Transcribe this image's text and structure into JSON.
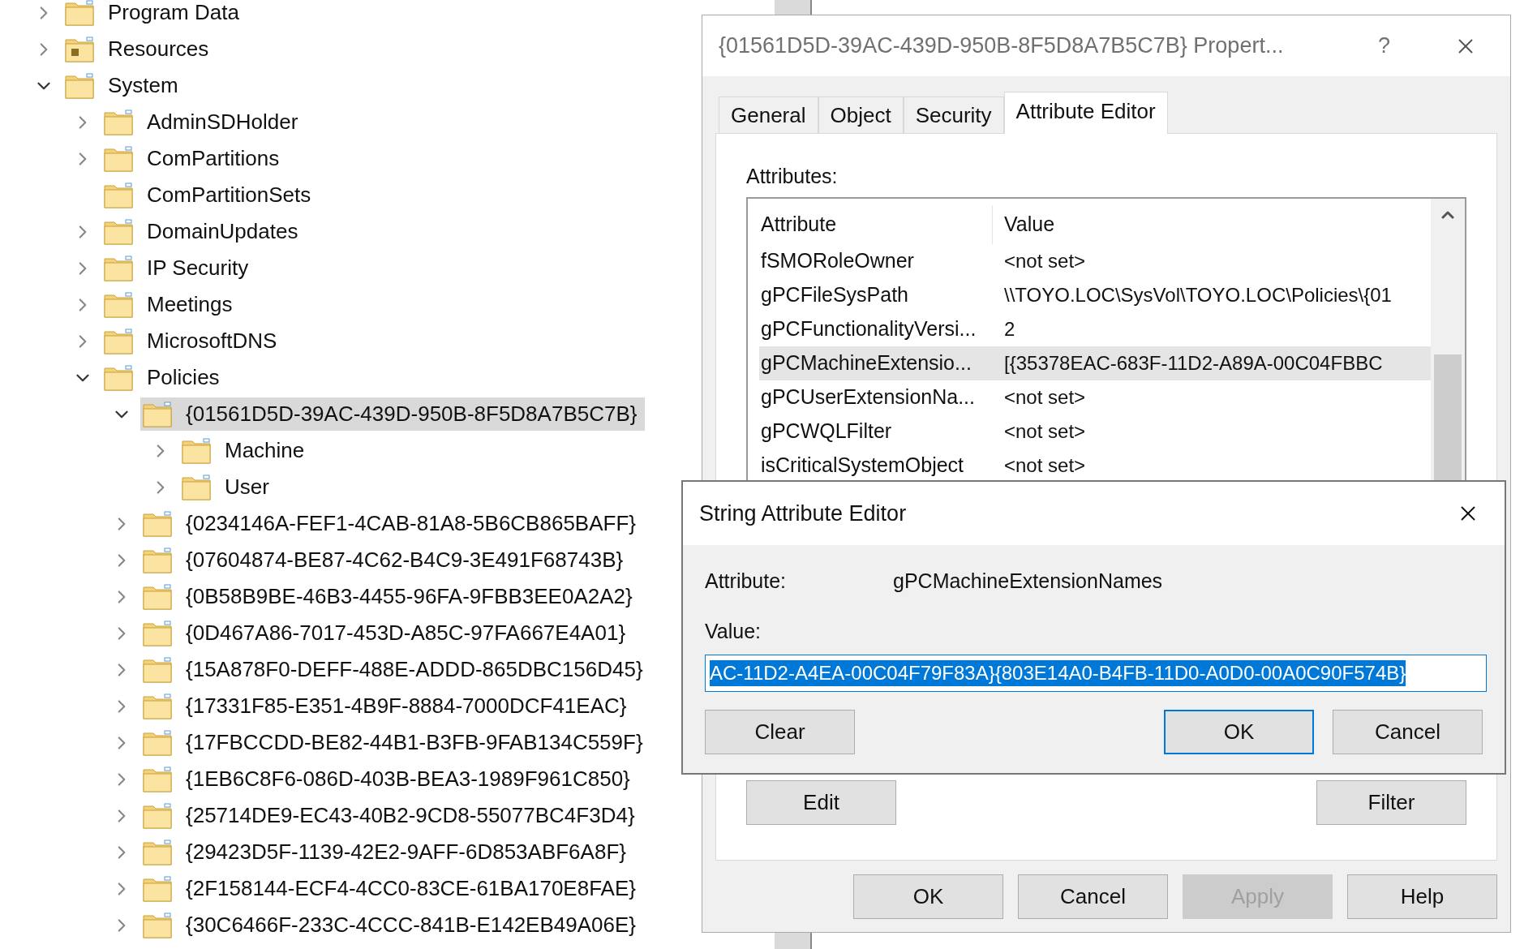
{
  "tree": [
    {
      "label": "Program Data",
      "kind": "folder",
      "expanded": false,
      "selected": false
    },
    {
      "label": "Resources",
      "kind": "container",
      "expanded": false,
      "selected": false
    },
    {
      "label": "System",
      "kind": "folder",
      "expanded": true,
      "selected": false,
      "children": [
        {
          "label": "AdminSDHolder",
          "kind": "folder",
          "expanded": false,
          "selected": false
        },
        {
          "label": "ComPartitions",
          "kind": "folder",
          "expanded": false,
          "selected": false
        },
        {
          "label": "ComPartitionSets",
          "kind": "folder",
          "selected": false
        },
        {
          "label": "DomainUpdates",
          "kind": "folder",
          "expanded": false,
          "selected": false
        },
        {
          "label": "IP Security",
          "kind": "folder",
          "expanded": false,
          "selected": false
        },
        {
          "label": "Meetings",
          "kind": "folder",
          "expanded": false,
          "selected": false
        },
        {
          "label": "MicrosoftDNS",
          "kind": "folder",
          "expanded": false,
          "selected": false
        },
        {
          "label": "Policies",
          "kind": "folder",
          "expanded": true,
          "selected": false,
          "children": [
            {
              "label": "{01561D5D-39AC-439D-950B-8F5D8A7B5C7B}",
              "kind": "folder",
              "expanded": true,
              "selected": true,
              "children": [
                {
                  "label": "Machine",
                  "kind": "folder",
                  "expanded": false,
                  "selected": false
                },
                {
                  "label": "User",
                  "kind": "folder",
                  "expanded": false,
                  "selected": false
                }
              ]
            },
            {
              "label": "{0234146A-FEF1-4CAB-81A8-5B6CB865BAFF}",
              "kind": "folder",
              "expanded": false,
              "selected": false
            },
            {
              "label": "{07604874-BE87-4C62-B4C9-3E491F68743B}",
              "kind": "folder",
              "expanded": false,
              "selected": false
            },
            {
              "label": "{0B58B9BE-46B3-4455-96FA-9FBB3EE0A2A2}",
              "kind": "folder",
              "expanded": false,
              "selected": false
            },
            {
              "label": "{0D467A86-7017-453D-A85C-97FA667E4A01}",
              "kind": "folder",
              "expanded": false,
              "selected": false
            },
            {
              "label": "{15A878F0-DEFF-488E-ADDD-865DBC156D45}",
              "kind": "folder",
              "expanded": false,
              "selected": false
            },
            {
              "label": "{17331F85-E351-4B9F-8884-7000DCF41EAC}",
              "kind": "folder",
              "expanded": false,
              "selected": false
            },
            {
              "label": "{17FBCCDD-BE82-44B1-B3FB-9FAB134C559F}",
              "kind": "folder",
              "expanded": false,
              "selected": false
            },
            {
              "label": "{1EB6C8F6-086D-403B-BEA3-1989F961C850}",
              "kind": "folder",
              "expanded": false,
              "selected": false
            },
            {
              "label": "{25714DE9-EC43-40B2-9CD8-55077BC4F3D4}",
              "kind": "folder",
              "expanded": false,
              "selected": false
            },
            {
              "label": "{29423D5F-1139-42E2-9AFF-6D853ABF6A8F}",
              "kind": "folder",
              "expanded": false,
              "selected": false
            },
            {
              "label": "{2F158144-ECF4-4CC0-83CE-61BA170E8FAE}",
              "kind": "folder",
              "expanded": false,
              "selected": false
            },
            {
              "label": "{30C6466F-233C-4CCC-841B-E142EB49A06E}",
              "kind": "folder",
              "expanded": false,
              "selected": false
            }
          ]
        }
      ]
    }
  ],
  "properties": {
    "title": "{01561D5D-39AC-439D-950B-8F5D8A7B5C7B} Propert...",
    "help": "?",
    "tabs": [
      {
        "label": "General",
        "selected": false
      },
      {
        "label": "Object",
        "selected": false
      },
      {
        "label": "Security",
        "selected": false
      },
      {
        "label": "Attribute Editor",
        "selected": true
      }
    ],
    "attributes_label": "Attributes:",
    "columns": [
      "Attribute",
      "Value"
    ],
    "rows": [
      {
        "attribute": "fSMORoleOwner",
        "value": "<not set>",
        "selected": false
      },
      {
        "attribute": "gPCFileSysPath",
        "value": "\\\\TOYO.LOC\\SysVol\\TOYO.LOC\\Policies\\{01",
        "selected": false
      },
      {
        "attribute": "gPCFunctionalityVersi...",
        "value": "2",
        "selected": false
      },
      {
        "attribute": "gPCMachineExtensio...",
        "value": "[{35378EAC-683F-11D2-A89A-00C04FBBC",
        "selected": true
      },
      {
        "attribute": "gPCUserExtensionNa...",
        "value": "<not set>",
        "selected": false
      },
      {
        "attribute": "gPCWQLFilter",
        "value": "<not set>",
        "selected": false
      },
      {
        "attribute": "isCriticalSystemObject",
        "value": "<not set>",
        "selected": false
      }
    ],
    "list_buttons": [
      "Edit",
      "Filter"
    ],
    "buttons": [
      {
        "label": "OK",
        "disabled": false
      },
      {
        "label": "Cancel",
        "disabled": false
      },
      {
        "label": "Apply",
        "disabled": true
      },
      {
        "label": "Help",
        "disabled": false
      }
    ]
  },
  "string_editor": {
    "title": "String Attribute Editor",
    "attribute_label": "Attribute:",
    "attribute_value": "gPCMachineExtensionNames",
    "value_label": "Value:",
    "value": "AC-11D2-A4EA-00C04F79F83A}{803E14A0-B4FB-11D0-A0D0-00A0C90F574B}",
    "value_selected": true,
    "clear": "Clear",
    "buttons": [
      {
        "label": "OK",
        "default": true
      },
      {
        "label": "Cancel",
        "default": false
      }
    ]
  }
}
